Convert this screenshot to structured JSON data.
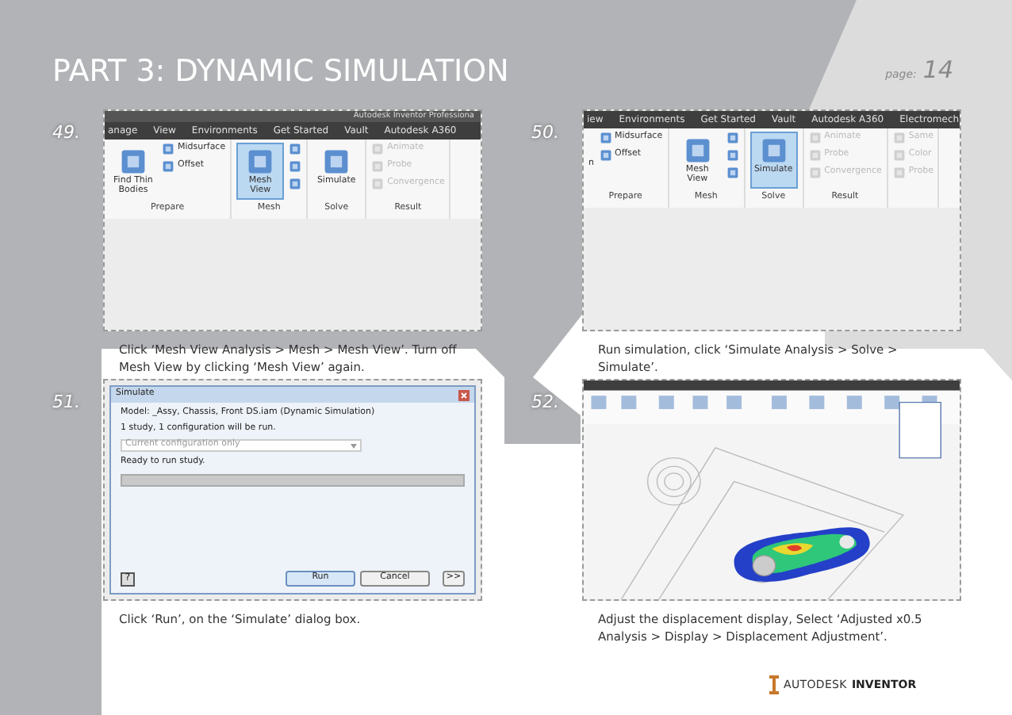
{
  "header": {
    "title": "PART 3: DYNAMIC SIMULATION",
    "page_label": "page:",
    "page_number": "14"
  },
  "steps": [
    {
      "number": "49.",
      "kind": "ribbon",
      "screen": {
        "window_title": "Autodesk Inventor Professiona",
        "tabs": [
          "anage",
          "View",
          "Environments",
          "Get Started",
          "Vault",
          "Autodesk A360"
        ],
        "groups": [
          {
            "label": "Prepare",
            "items": [
              {
                "label": "Find Thin Bodies",
                "kind": "large",
                "selected": false,
                "disabled": false
              },
              {
                "label": "Midsurface",
                "kind": "small",
                "selected": false,
                "disabled": false
              },
              {
                "label": "Offset",
                "kind": "small",
                "selected": false,
                "disabled": false
              }
            ]
          },
          {
            "label": "Mesh",
            "items": [
              {
                "label": "Mesh View",
                "kind": "large",
                "selected": true,
                "disabled": false
              },
              {
                "kind": "icon",
                "selected": false,
                "disabled": false
              },
              {
                "kind": "icon",
                "selected": false,
                "disabled": false
              },
              {
                "kind": "icon",
                "selected": false,
                "disabled": false
              }
            ]
          },
          {
            "label": "Solve",
            "items": [
              {
                "label": "Simulate",
                "kind": "large",
                "selected": false,
                "disabled": false
              }
            ]
          },
          {
            "label": "Result",
            "items": [
              {
                "label": "Animate",
                "kind": "small",
                "selected": false,
                "disabled": true
              },
              {
                "label": "Probe",
                "kind": "small",
                "selected": false,
                "disabled": true
              },
              {
                "label": "Convergence",
                "kind": "small",
                "selected": false,
                "disabled": true
              }
            ]
          }
        ]
      },
      "caption": "Click ‘Mesh View Analysis > Mesh > Mesh View’. Turn off Mesh View by clicking ‘Mesh View’ again."
    },
    {
      "number": "50.",
      "kind": "ribbon",
      "screen": {
        "tabs": [
          "iew",
          "Environments",
          "Get Started",
          "Vault",
          "Autodesk A360",
          "Electromech"
        ],
        "groups": [
          {
            "label": "Prepare",
            "items": [
              {
                "label": "n",
                "kind": "cut",
                "selected": false,
                "disabled": false
              },
              {
                "label": "Midsurface",
                "kind": "small",
                "selected": false,
                "disabled": false
              },
              {
                "label": "Offset",
                "kind": "small",
                "selected": false,
                "disabled": false
              }
            ]
          },
          {
            "label": "Mesh",
            "items": [
              {
                "label": "Mesh View",
                "kind": "large",
                "selected": false,
                "disabled": false
              },
              {
                "kind": "icon",
                "selected": false,
                "disabled": false
              },
              {
                "kind": "icon",
                "selected": false,
                "disabled": false
              },
              {
                "kind": "icon",
                "selected": false,
                "disabled": false
              }
            ]
          },
          {
            "label": "Solve",
            "items": [
              {
                "label": "Simulate",
                "kind": "large",
                "selected": true,
                "disabled": false
              }
            ]
          },
          {
            "label": "Result",
            "items": [
              {
                "label": "Animate",
                "kind": "small",
                "selected": false,
                "disabled": true
              },
              {
                "label": "Probe",
                "kind": "small",
                "selected": false,
                "disabled": true
              },
              {
                "label": "Convergence",
                "kind": "small",
                "selected": false,
                "disabled": true
              }
            ]
          },
          {
            "items": [
              {
                "label": "Same",
                "kind": "small",
                "selected": false,
                "disabled": true
              },
              {
                "label": "Color",
                "kind": "small",
                "selected": false,
                "disabled": true
              },
              {
                "label": "Probe",
                "kind": "small",
                "selected": false,
                "disabled": true
              }
            ]
          }
        ]
      },
      "caption": "Run simulation, click ‘Simulate Analysis > Solve > Simulate’."
    },
    {
      "number": "51.",
      "kind": "dialog",
      "screen": {
        "title": "Simulate",
        "model": "Model: _Assy, Chassis, Front DS.iam (Dynamic Simulation)",
        "info": "1 study, 1 configuration will be run.",
        "select": "Current configuration only",
        "status": "Ready to run study.",
        "progress": {
          "level": 0
        },
        "help": "?",
        "buttons": [
          "Run",
          "Cancel"
        ],
        "more": ">>"
      },
      "caption": "Click ‘Run’, on the ‘Simulate’ dialog box."
    },
    {
      "number": "52.",
      "kind": "result",
      "caption": "Adjust the displacement display, Select ‘Adjusted x0.5 Analysis > Display > Displacement Adjustment’."
    }
  ],
  "logo": {
    "brand": "AUTODESK",
    "product": "INVENTOR"
  }
}
